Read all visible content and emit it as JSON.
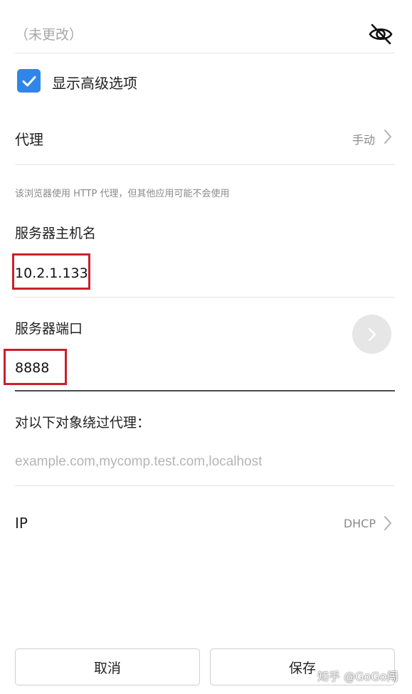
{
  "password": {
    "placeholder": "（未更改）",
    "icon": "eye-off-icon"
  },
  "advanced": {
    "label": "显示高级选项",
    "checked": true,
    "accent": "#2f86e8"
  },
  "proxy": {
    "label": "代理",
    "value": "手动",
    "note": "该浏览器使用 HTTP 代理，但其他应用可能不会使用"
  },
  "host": {
    "label": "服务器主机名",
    "value": "10.2.1.133"
  },
  "port": {
    "label": "服务器端口",
    "value": "8888"
  },
  "bypass": {
    "label": "对以下对象绕过代理：",
    "placeholder": "example.com,mycomp.test.com,localhost"
  },
  "ip": {
    "label": "IP",
    "value": "DHCP"
  },
  "actions": {
    "cancel": "取消",
    "save": "保存"
  },
  "watermark": "知乎 @GoGo闯",
  "highlight_color": "#c8212c"
}
